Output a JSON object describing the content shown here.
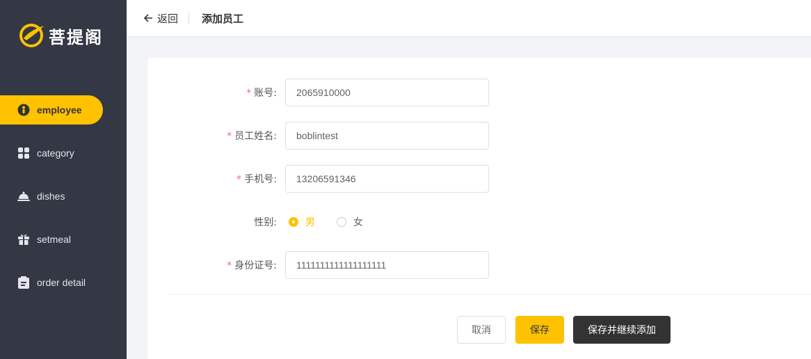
{
  "app": {
    "logo_text": "菩提阁"
  },
  "sidebar": {
    "items": [
      {
        "label": "employee",
        "icon": "employee-icon",
        "active": true
      },
      {
        "label": "category",
        "icon": "grid-icon",
        "active": false
      },
      {
        "label": "dishes",
        "icon": "cloche-icon",
        "active": false
      },
      {
        "label": "setmeal",
        "icon": "gift-icon",
        "active": false
      },
      {
        "label": "order detail",
        "icon": "clipboard-icon",
        "active": false
      }
    ]
  },
  "header": {
    "back_label": "返回",
    "title": "添加员工"
  },
  "form": {
    "account": {
      "label": "账号:",
      "value": "2065910000"
    },
    "name": {
      "label": "员工姓名:",
      "value": "boblintest"
    },
    "phone": {
      "label": "手机号:",
      "value": "13206591346"
    },
    "gender": {
      "label": "性别:",
      "options": [
        "男",
        "女"
      ],
      "selected": "男"
    },
    "id_number": {
      "label": "身份证号:",
      "value": "1111111111111111111"
    },
    "required_mark": "*"
  },
  "buttons": {
    "cancel": "取消",
    "save": "保存",
    "save_and_add": "保存并继续添加"
  },
  "colors": {
    "accent": "#ffc200",
    "sidebar_bg": "#343744",
    "dark_button": "#333333",
    "required": "#f56c6c"
  }
}
